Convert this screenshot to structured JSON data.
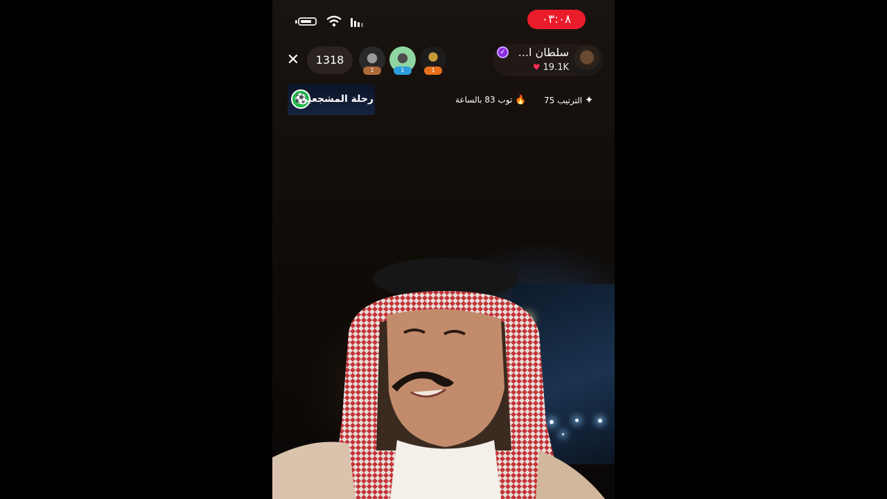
{
  "status_bar": {
    "timer": "٠٣:٠٨"
  },
  "top_bar": {
    "viewer_count": "1318",
    "top_viewers": [
      {
        "badge": "1",
        "badge_color": "#b06a3a"
      },
      {
        "badge": "1",
        "badge_color": "#2d9cdb"
      },
      {
        "badge": "1",
        "badge_color": "#e8701a"
      }
    ],
    "host": {
      "name": "سلطان ا...",
      "likes": "19.1K"
    }
  },
  "sponsor": {
    "label": "رحلة المشجعين"
  },
  "stats": {
    "hourly_top": "توب 83 بالساعة",
    "rank": "الترتيب 75"
  },
  "colors": {
    "live_red": "#ea1c2c",
    "verified_purple": "#8a2be2",
    "heart": "#ff2d55"
  }
}
